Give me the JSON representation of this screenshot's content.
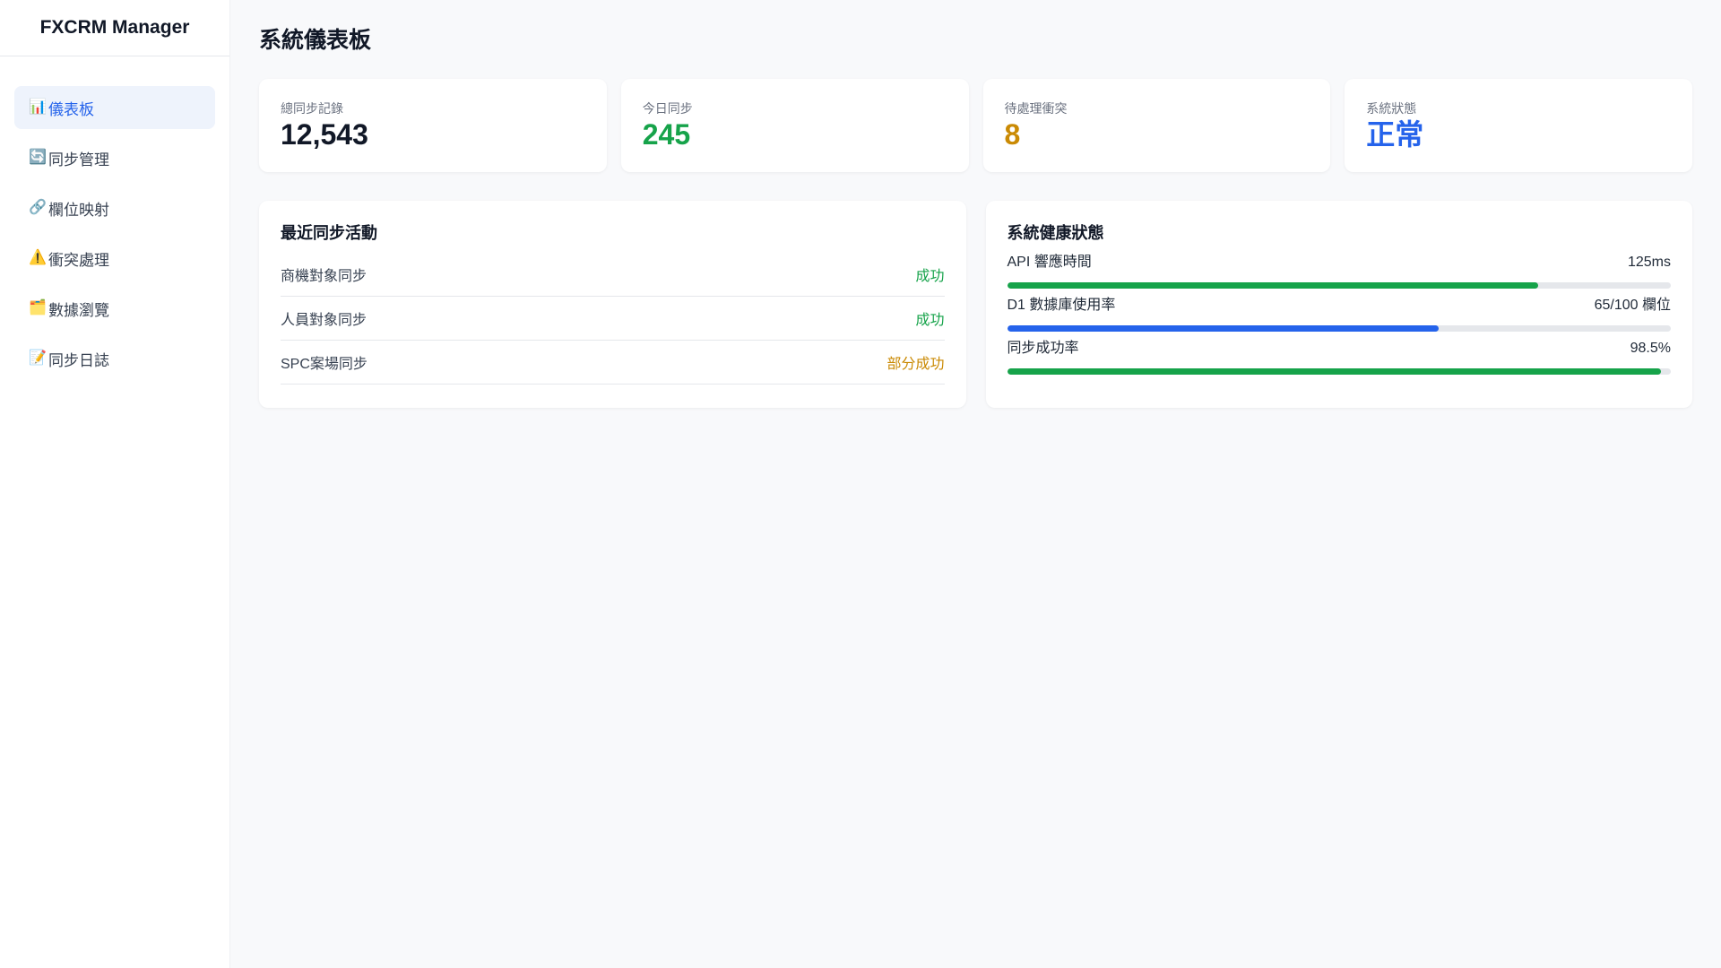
{
  "brand": "FXCRM Manager",
  "nav": [
    {
      "icon": "📊",
      "icon_name": "bar-chart-icon",
      "label": "儀表板",
      "active": true
    },
    {
      "icon": "🔄",
      "icon_name": "sync-icon",
      "label": "同步管理"
    },
    {
      "icon": "🔗",
      "icon_name": "link-icon",
      "label": "欄位映射"
    },
    {
      "icon": "⚠️",
      "icon_name": "warning-icon",
      "label": "衝突處理"
    },
    {
      "icon": "🗂️",
      "icon_name": "folder-icon",
      "label": "數據瀏覽"
    },
    {
      "icon": "📝",
      "icon_name": "memo-icon",
      "label": "同步日誌"
    }
  ],
  "page_title": "系統儀表板",
  "stats": [
    {
      "label": "總同步記錄",
      "value": "12,543",
      "color": "#111827"
    },
    {
      "label": "今日同步",
      "value": "245",
      "color": "#16a34a"
    },
    {
      "label": "待處理衝突",
      "value": "8",
      "color": "#ca8a04"
    },
    {
      "label": "系統狀態",
      "value": "正常",
      "color": "#2563eb"
    }
  ],
  "activity": {
    "title": "最近同步活動",
    "rows": [
      {
        "name": "商機對象同步",
        "status": "成功",
        "status_color": "#16a34a"
      },
      {
        "name": "人員對象同步",
        "status": "成功",
        "status_color": "#16a34a"
      },
      {
        "name": "SPC案場同步",
        "status": "部分成功",
        "status_color": "#ca8a04"
      }
    ]
  },
  "health": {
    "title": "系統健康狀態",
    "items": [
      {
        "label": "API 響應時間",
        "value": "125ms",
        "fill_fraction": 0.8,
        "color": "#16a34a"
      },
      {
        "label": "D1 數據庫使用率",
        "value": "65/100 欄位",
        "fill_fraction": 0.65,
        "color": "#2563eb"
      },
      {
        "label": "同步成功率",
        "value": "98.5%",
        "fill_fraction": 0.985,
        "color": "#16a34a"
      }
    ]
  },
  "colors": {
    "accent": "#2563eb",
    "success": "#16a34a",
    "warning": "#ca8a04",
    "active_nav_bg": "#eef3fc"
  }
}
